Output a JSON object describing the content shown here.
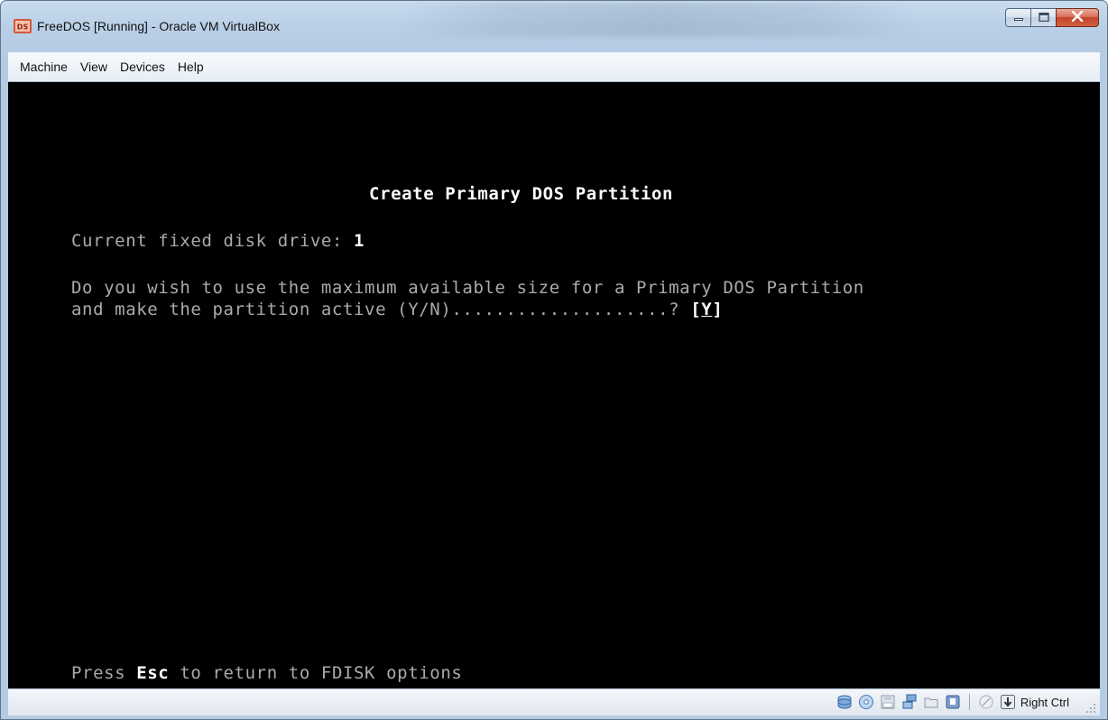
{
  "window": {
    "title": "FreeDOS [Running] - Oracle VM VirtualBox"
  },
  "menubar": {
    "items": [
      {
        "label": "Machine"
      },
      {
        "label": "View"
      },
      {
        "label": "Devices"
      },
      {
        "label": "Help"
      }
    ]
  },
  "dos_screen": {
    "title": "Create Primary DOS Partition",
    "drive_label": "Current fixed disk drive: ",
    "drive_value": "1",
    "question_line1": "Do you wish to use the maximum available size for a Primary DOS Partition",
    "question_line2": "and make the partition active (Y/N)....................? ",
    "answer_open": "[",
    "answer_value": "Y",
    "answer_close": "]",
    "footer_prefix": "Press ",
    "footer_key": "Esc",
    "footer_suffix": " to return to FDISK options"
  },
  "statusbar": {
    "icons": [
      "hard-disk-icon",
      "optical-drive-icon",
      "floppy-icon",
      "network-icon",
      "shared-folder-icon",
      "usb-icon",
      "mouse-integration-icon",
      "host-key-arrow-icon"
    ],
    "host_key": "Right Ctrl"
  },
  "colors": {
    "screen_background": "#000000",
    "dos_text": "#aaaaaa",
    "dos_highlight": "#ffffff",
    "close_button": "#c4452b"
  }
}
